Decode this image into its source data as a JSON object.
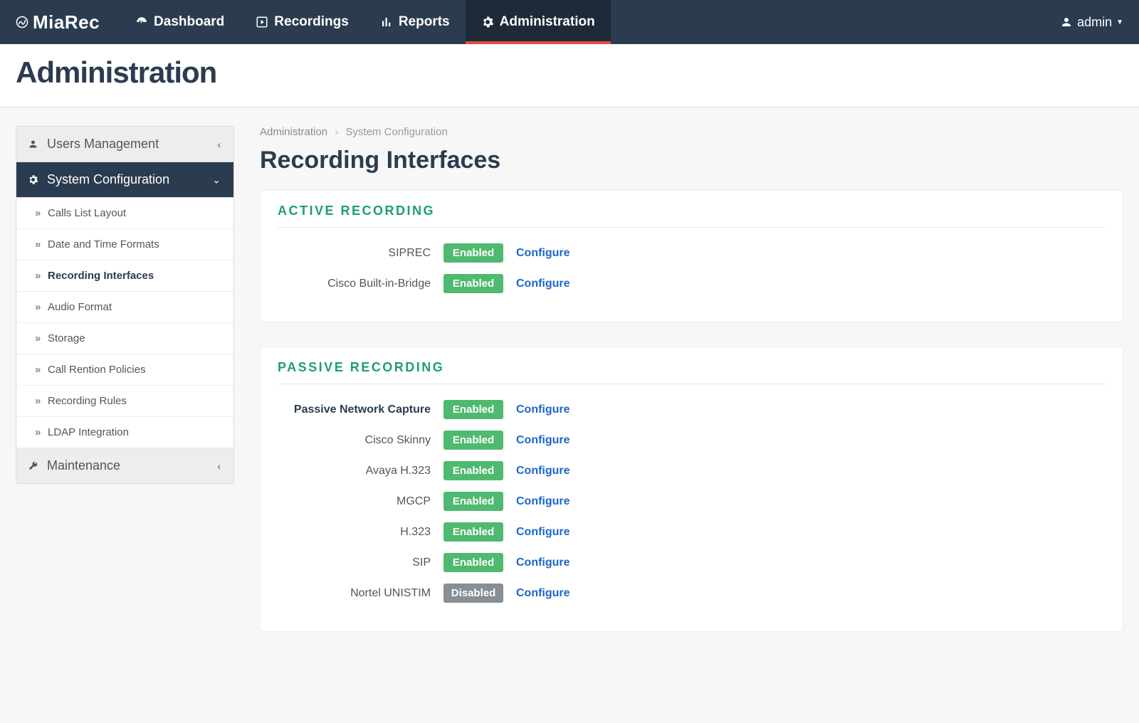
{
  "brand": "MiaRec",
  "nav": {
    "dashboard": "Dashboard",
    "recordings": "Recordings",
    "reports": "Reports",
    "administration": "Administration"
  },
  "user": {
    "label": "admin"
  },
  "page_title": "Administration",
  "breadcrumb": {
    "root": "Administration",
    "section": "System Configuration"
  },
  "sidebar": {
    "users_mgmt": "Users Management",
    "sys_conf": "System Configuration",
    "maintenance": "Maintenance",
    "items": [
      "Calls List Layout",
      "Date and Time Formats",
      "Recording Interfaces",
      "Audio Format",
      "Storage",
      "Call Rention Policies",
      "Recording Rules",
      "LDAP Integration"
    ]
  },
  "content_title": "Recording Interfaces",
  "status": {
    "enabled": "Enabled",
    "disabled": "Disabled"
  },
  "configure_label": "Configure",
  "active_section": {
    "title": "ACTIVE  RECORDING",
    "rows": [
      {
        "name": "SIPREC",
        "status": "enabled"
      },
      {
        "name": "Cisco Built-in-Bridge",
        "status": "enabled"
      }
    ]
  },
  "passive_section": {
    "title": "PASSIVE  RECORDING",
    "rows": [
      {
        "name": "Passive Network Capture",
        "status": "enabled",
        "bold": true
      },
      {
        "name": "Cisco Skinny",
        "status": "enabled"
      },
      {
        "name": "Avaya H.323",
        "status": "enabled"
      },
      {
        "name": "MGCP",
        "status": "enabled"
      },
      {
        "name": "H.323",
        "status": "enabled"
      },
      {
        "name": "SIP",
        "status": "enabled"
      },
      {
        "name": "Nortel UNISTIM",
        "status": "disabled"
      }
    ]
  }
}
